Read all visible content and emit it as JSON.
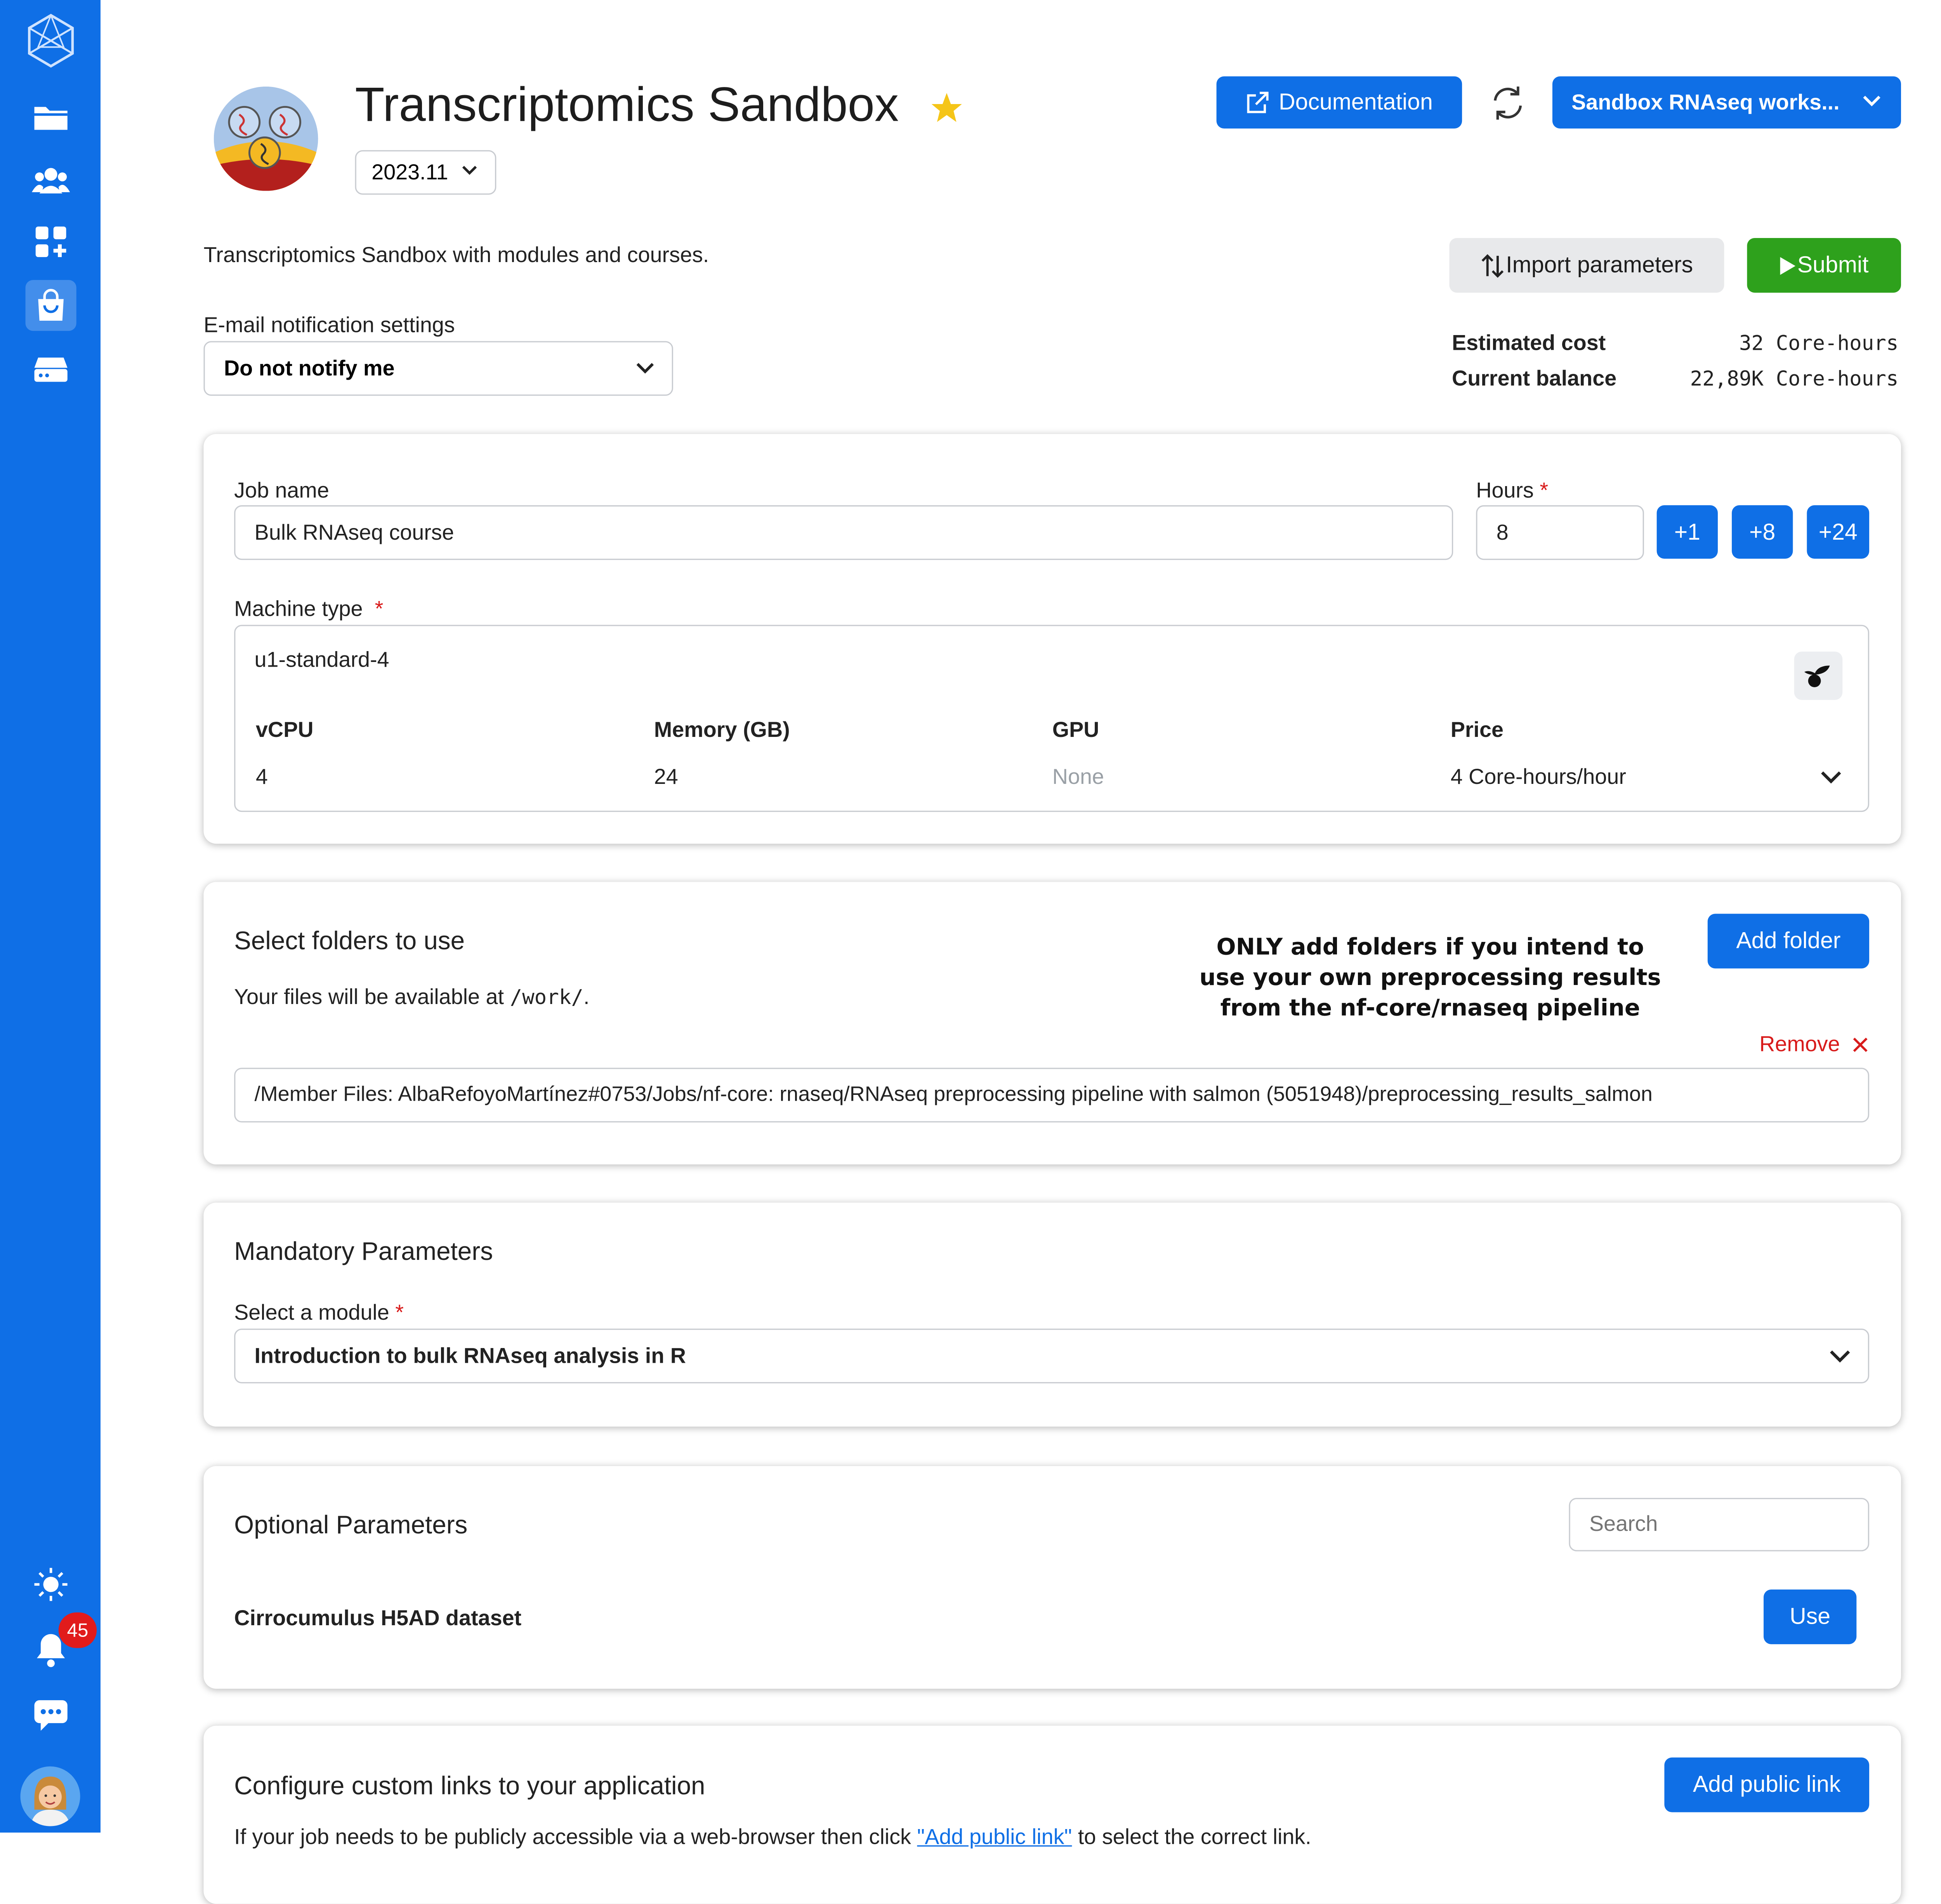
{
  "sidebar": {
    "notification_count": "45",
    "icons": [
      "hexagon-logo-icon",
      "folder-icon",
      "users-icon",
      "apps-icon",
      "shopping-bag-icon",
      "server-icon",
      "sun-icon",
      "bell-icon",
      "chat-icon",
      "user-avatar"
    ]
  },
  "header": {
    "app_title": "Transcriptomics Sandbox",
    "version": "2023.11",
    "documentation_label": "Documentation",
    "workspace_label": "Sandbox RNAseq works...",
    "description": "Transcriptomics Sandbox with modules and courses.",
    "import_label": "Import parameters",
    "submit_label": "Submit"
  },
  "email": {
    "label": "E-mail notification settings",
    "value": "Do not notify me"
  },
  "cost": {
    "estimated_label": "Estimated cost",
    "estimated_value": "32 Core-hours",
    "balance_label": "Current balance",
    "balance_value": "22,89K Core-hours"
  },
  "job": {
    "name_label": "Job name",
    "name_value": "Bulk RNAseq course",
    "hours_label": "Hours",
    "hours_value": "8",
    "hour_buttons": [
      "+1",
      "+8",
      "+24"
    ],
    "machine_label": "Machine type",
    "machine_name": "u1-standard-4",
    "columns": [
      "vCPU",
      "Memory (GB)",
      "GPU",
      "Price"
    ],
    "values": [
      "4",
      "24",
      "None",
      "4 Core-hours/hour"
    ]
  },
  "folders": {
    "title": "Select folders to use",
    "info_prefix": "Your files will be available at",
    "info_path": "/work/",
    "info_suffix": ".",
    "warning_line1": "ONLY add folders if you intend to",
    "warning_line2": "use your own preprocessing results",
    "warning_line3": "from the nf-core/rnaseq pipeline",
    "add_label": "Add folder",
    "remove_label": "Remove",
    "path": "/Member Files: AlbaRefoyoMartínez#0753/Jobs/nf-core: rnaseq/RNAseq preprocessing pipeline with salmon (5051948)/preprocessing_results_salmon"
  },
  "mandatory": {
    "title": "Mandatory Parameters",
    "module_label": "Select a module",
    "module_value": "Introduction to bulk RNAseq analysis in R"
  },
  "optional": {
    "title": "Optional Parameters",
    "search_placeholder": "Search",
    "item_label": "Cirrocumulus H5AD dataset",
    "use_label": "Use"
  },
  "links": {
    "title": "Configure custom links to your application",
    "add_label": "Add public link",
    "text_prefix": "If your job needs to be publicly accessible via a web-browser then click",
    "text_link": "\"Add public link\"",
    "text_suffix": "to select the correct link."
  },
  "colors": {
    "accent": "#0f6fe6",
    "submit": "#2ea11c",
    "required": "#d81b1b",
    "star": "#f5c518"
  }
}
